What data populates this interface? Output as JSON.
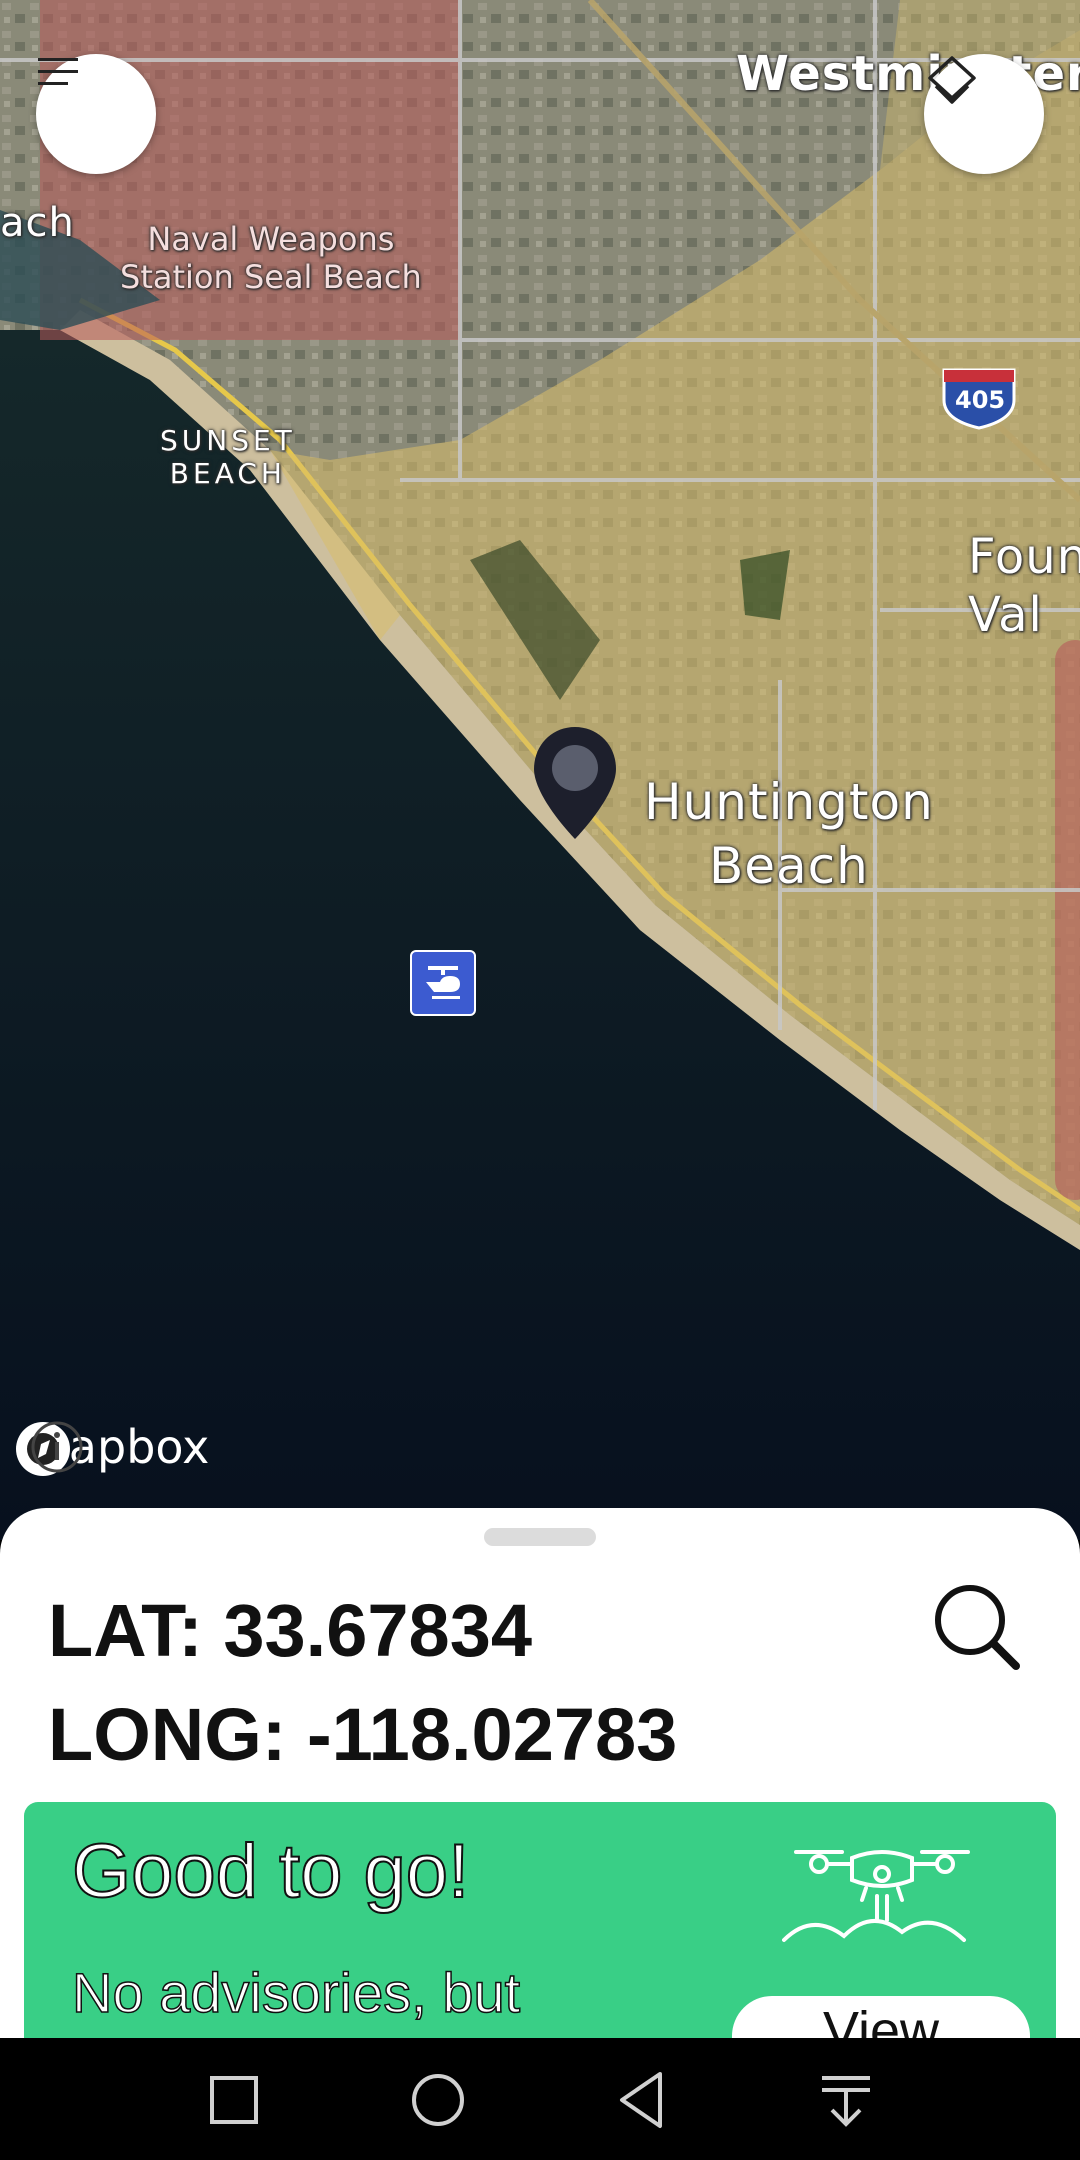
{
  "map": {
    "labels": {
      "westminster": "Westminster",
      "naval_weapons": "Naval Weapons\nStation Seal Beach",
      "seal_beach_partial": "ach",
      "sunset_beach": "SUNSET\nBEACH",
      "huntington_beach": "Huntington\nBeach",
      "fountain_valley": "Foun\nVal",
      "interstate": "405"
    },
    "attribution": "mapbox",
    "icons": {
      "menu": "menu-icon",
      "layers": "layers-icon",
      "pin": "location-pin-icon",
      "heliport": "helicopter-icon",
      "info": "info-icon"
    }
  },
  "sheet": {
    "lat_label": "LAT: 33.67834",
    "long_label": "LONG: -118.02783",
    "status": {
      "title": "Good to go!",
      "description": "No advisories, but",
      "button": "View"
    }
  },
  "colors": {
    "status_green": "#39cf86",
    "restricted_red": "#b85a5a",
    "caution_yellow": "#d8bd6a"
  },
  "navbar": {
    "icons": [
      "recents-icon",
      "home-icon",
      "back-icon",
      "notifications-pull-icon"
    ]
  }
}
